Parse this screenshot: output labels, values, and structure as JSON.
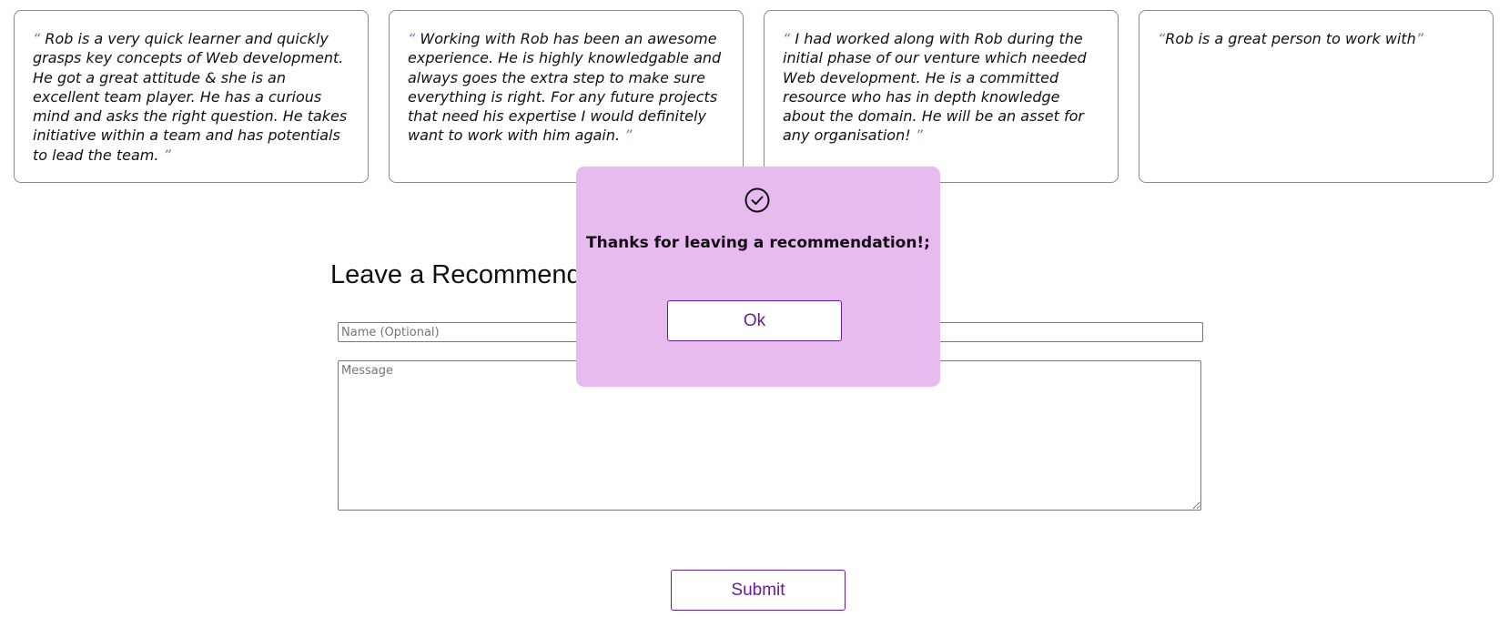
{
  "recommendations": [
    {
      "open_quote": "“",
      "text": " Rob is a very quick learner and quickly grasps key concepts of Web development. He got a great attitude & she is an excellent team player. He has a curious mind and asks the right question. He takes initiative within a team and has potentials to lead the team. ",
      "close_quote": "”"
    },
    {
      "open_quote": "“",
      "text": " Working with Rob has been an awesome experience. He is highly knowledgable and always goes the extra step to make sure everything is right. For any future projects that need his expertise I would definitely want to work with him again. ",
      "close_quote": "”"
    },
    {
      "open_quote": "“",
      "text": " I had worked along with Rob during the initial phase of our venture which needed Web development. He is a committed resource who has in depth knowledge about the domain. He will be an asset for any organisation! ",
      "close_quote": "”"
    },
    {
      "open_quote": "“",
      "text": "Rob is a great person to work with",
      "close_quote": "”"
    }
  ],
  "form": {
    "title": "Leave a Recommendation",
    "name_placeholder": "Name (Optional)",
    "name_value": "",
    "message_placeholder": "Message",
    "message_value": "",
    "submit_label": "Submit"
  },
  "modal": {
    "icon": "check-circle-icon",
    "message": "Thanks for leaving a recommendation!;",
    "ok_label": "Ok"
  },
  "colors": {
    "accent": "#6a1b9a",
    "quote_mark": "#a25ec2",
    "modal_background": "#e7bbf0"
  }
}
